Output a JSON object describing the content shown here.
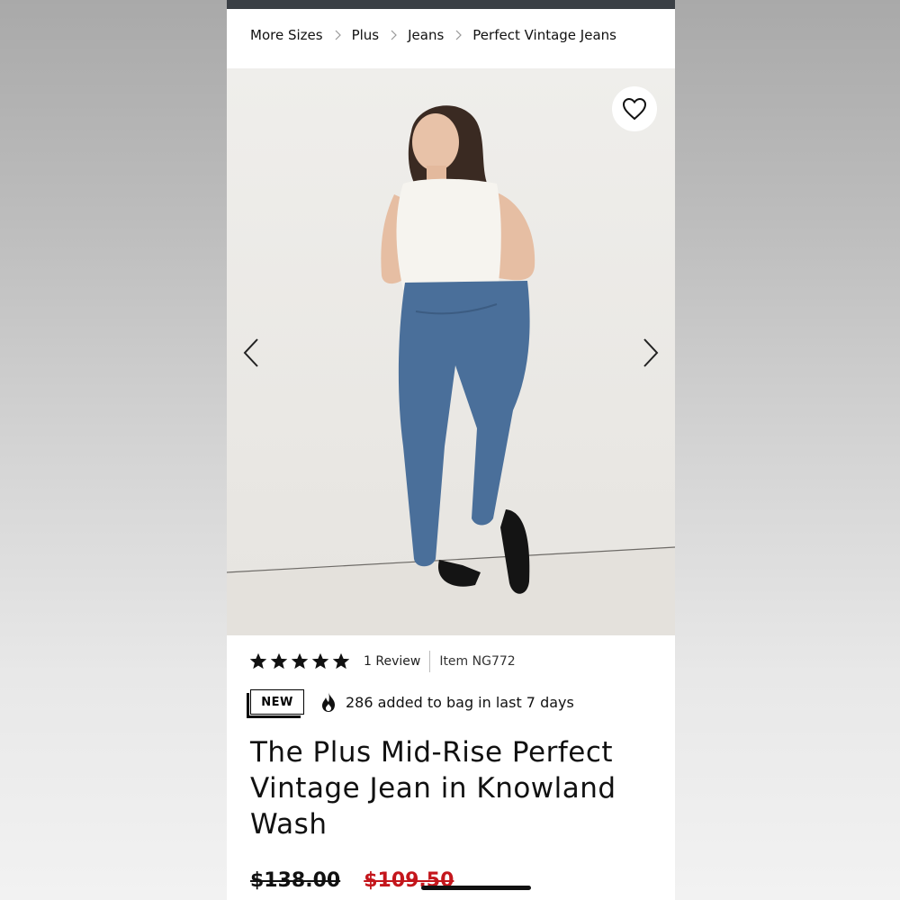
{
  "breadcrumb": {
    "items": [
      "More Sizes",
      "Plus",
      "Jeans",
      "Perfect Vintage Jeans"
    ]
  },
  "gallery": {
    "favorite_icon": "heart-outline-icon",
    "prev_icon": "chevron-left-icon",
    "next_icon": "chevron-right-icon"
  },
  "product": {
    "rating_stars": 5,
    "reviews": "1 Review",
    "item_number": "Item NG772",
    "badge": "NEW",
    "popularity": "286 added to bag in last 7 days",
    "title": "The Plus Mid-Rise Perfect Vintage Jean in Knowland Wash",
    "price_original": "$138.00",
    "price_sale": "$109.50"
  },
  "colors": {
    "sale_red": "#c4161c",
    "top_bar": "#3a3f45"
  }
}
